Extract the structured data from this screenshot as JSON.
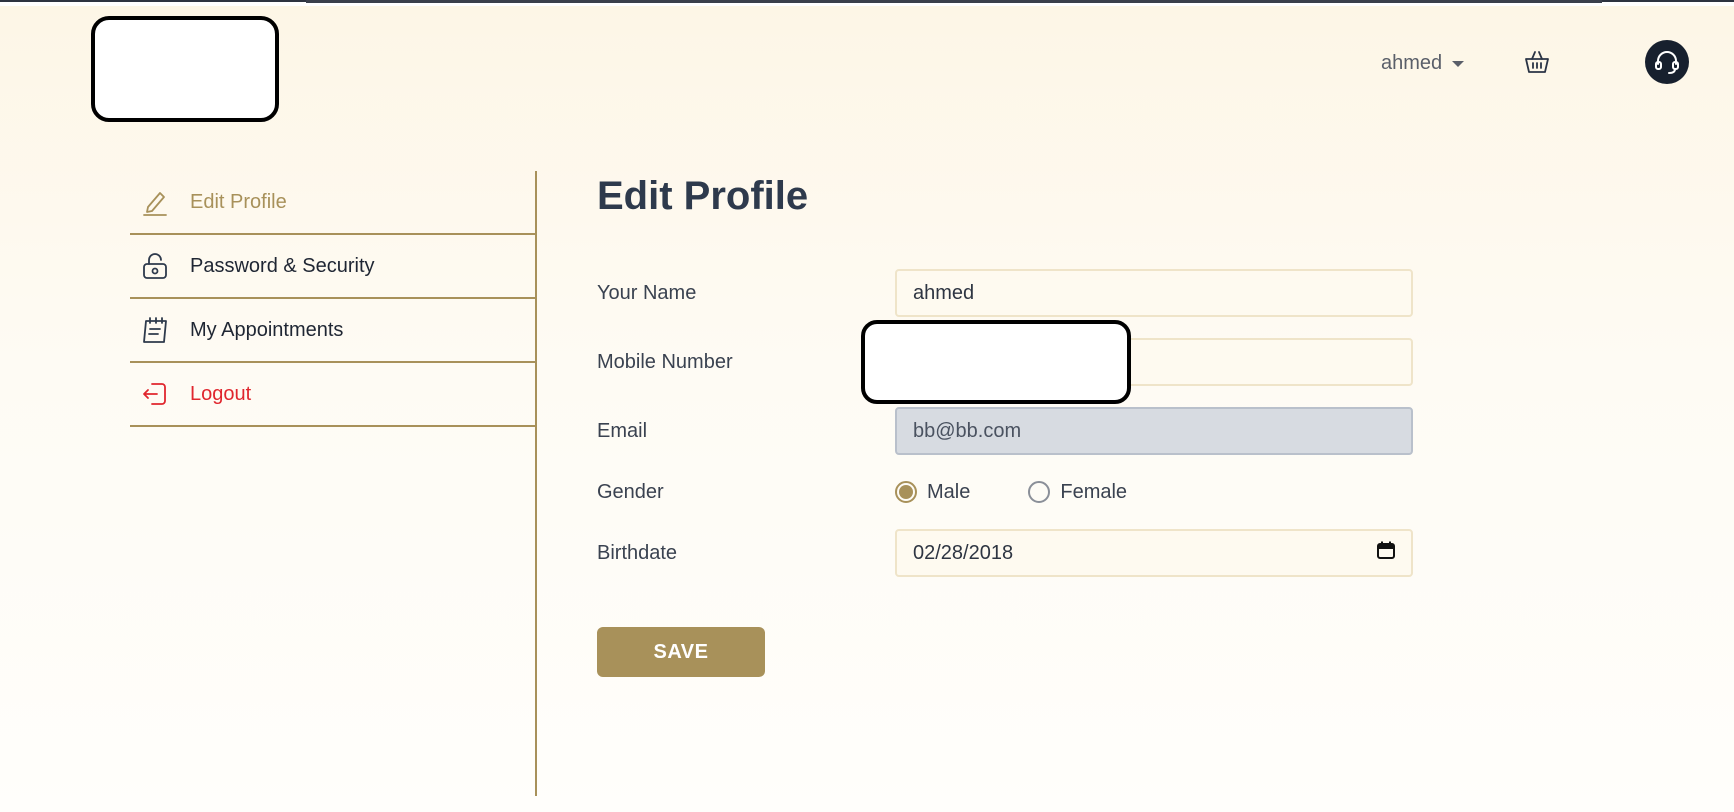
{
  "header": {
    "user_name": "ahmed",
    "basket_icon": "basket-icon",
    "support_icon": "headset-icon"
  },
  "sidebar": {
    "items": [
      {
        "label": "Edit Profile",
        "icon": "pencil-icon",
        "active": true
      },
      {
        "label": "Password & Security",
        "icon": "lock-icon"
      },
      {
        "label": "My Appointments",
        "icon": "calendar-icon"
      },
      {
        "label": "Logout",
        "icon": "logout-icon"
      }
    ]
  },
  "main": {
    "title": "Edit Profile",
    "fields": {
      "name": {
        "label": "Your Name",
        "value": "ahmed"
      },
      "mobile": {
        "label": "Mobile Number",
        "value": ""
      },
      "email": {
        "label": "Email",
        "value": "bb@bb.com"
      },
      "gender": {
        "label": "Gender",
        "options": [
          "Male",
          "Female"
        ],
        "selected": "Male"
      },
      "birthdate": {
        "label": "Birthdate",
        "value": "02/28/2018"
      }
    },
    "save_label": "SAVE"
  },
  "colors": {
    "accent": "#a8915a",
    "logout": "#e0262e",
    "text": "#2e3a4c"
  }
}
